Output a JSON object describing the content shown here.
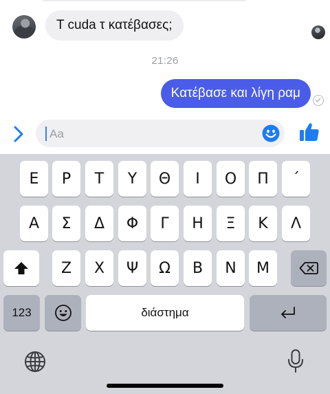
{
  "chat": {
    "incoming_message": "T cuda τ κατέβασες;",
    "timestamp": "21:26",
    "outgoing_message": "Κατέβασε και λίγη ραμ"
  },
  "composer": {
    "placeholder": "Aa"
  },
  "keyboard": {
    "row1": [
      "Ε",
      "Ρ",
      "Τ",
      "Υ",
      "Θ",
      "Ι",
      "Ο",
      "Π",
      "´"
    ],
    "row2": [
      "Α",
      "Σ",
      "Δ",
      "Φ",
      "Γ",
      "Η",
      "Ξ",
      "Κ",
      "Λ"
    ],
    "row3": [
      "Ζ",
      "Χ",
      "Ψ",
      "Ω",
      "Β",
      "Ν",
      "Μ"
    ],
    "numbers_label": "123",
    "space_label": "διάστημα"
  },
  "colors": {
    "outgoing_bubble": "#4a5ce8",
    "accent_blue": "#1d7cf2",
    "incoming_bubble": "#efeff1",
    "keyboard_bg": "#d3d5db"
  },
  "icons": [
    "chevron-right-icon",
    "emoji-icon",
    "thumbs-up-icon",
    "shift-icon",
    "backspace-icon",
    "emoji-key-icon",
    "return-icon",
    "globe-icon",
    "microphone-icon",
    "sent-check-icon"
  ]
}
